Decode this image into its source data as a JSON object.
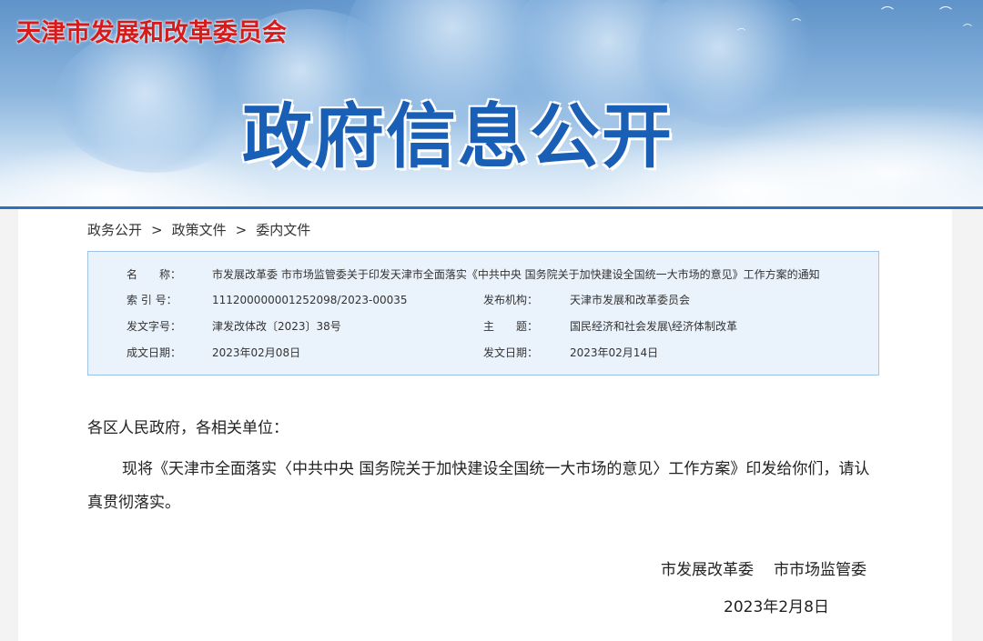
{
  "header": {
    "site_title": "天津市发展和改革委员会",
    "banner_title": "政府信息公开",
    "colors": {
      "site_title": "#d41c1c",
      "banner_title": "#1a5fb6",
      "accent_line": "#2f6fc0"
    }
  },
  "breadcrumb": {
    "items": [
      "政务公开",
      "政策文件",
      "委内文件"
    ],
    "separator": ">"
  },
  "info": {
    "name_label": "名　　称：",
    "name_value": "市发展改革委 市市场监管委关于印发天津市全面落实《中共中央 国务院关于加快建设全国统一大市场的意见》工作方案的通知",
    "index_label": "索 引 号：",
    "index_value": "111200000001252098/2023-00035",
    "publisher_label": "发布机构：",
    "publisher_value": "天津市发展和改革委员会",
    "doc_no_label": "发文字号：",
    "doc_no_value": "津发改体改〔2023〕38号",
    "topic_label": "主　　题：",
    "topic_value": "国民经济和社会发展\\经济体制改革",
    "created_label": "成文日期：",
    "created_value": "2023年02月08日",
    "issued_label": "发文日期：",
    "issued_value": "2023年02月14日"
  },
  "letter": {
    "salutation": "各区人民政府，各相关单位：",
    "body": "现将《天津市全面落实〈中共中央 国务院关于加快建设全国统一大市场的意见〉工作方案》印发给你们，请认真贯彻落实。",
    "signer_1": "市发展改革委",
    "signer_2": "市市场监管委",
    "date": "2023年2月8日"
  }
}
